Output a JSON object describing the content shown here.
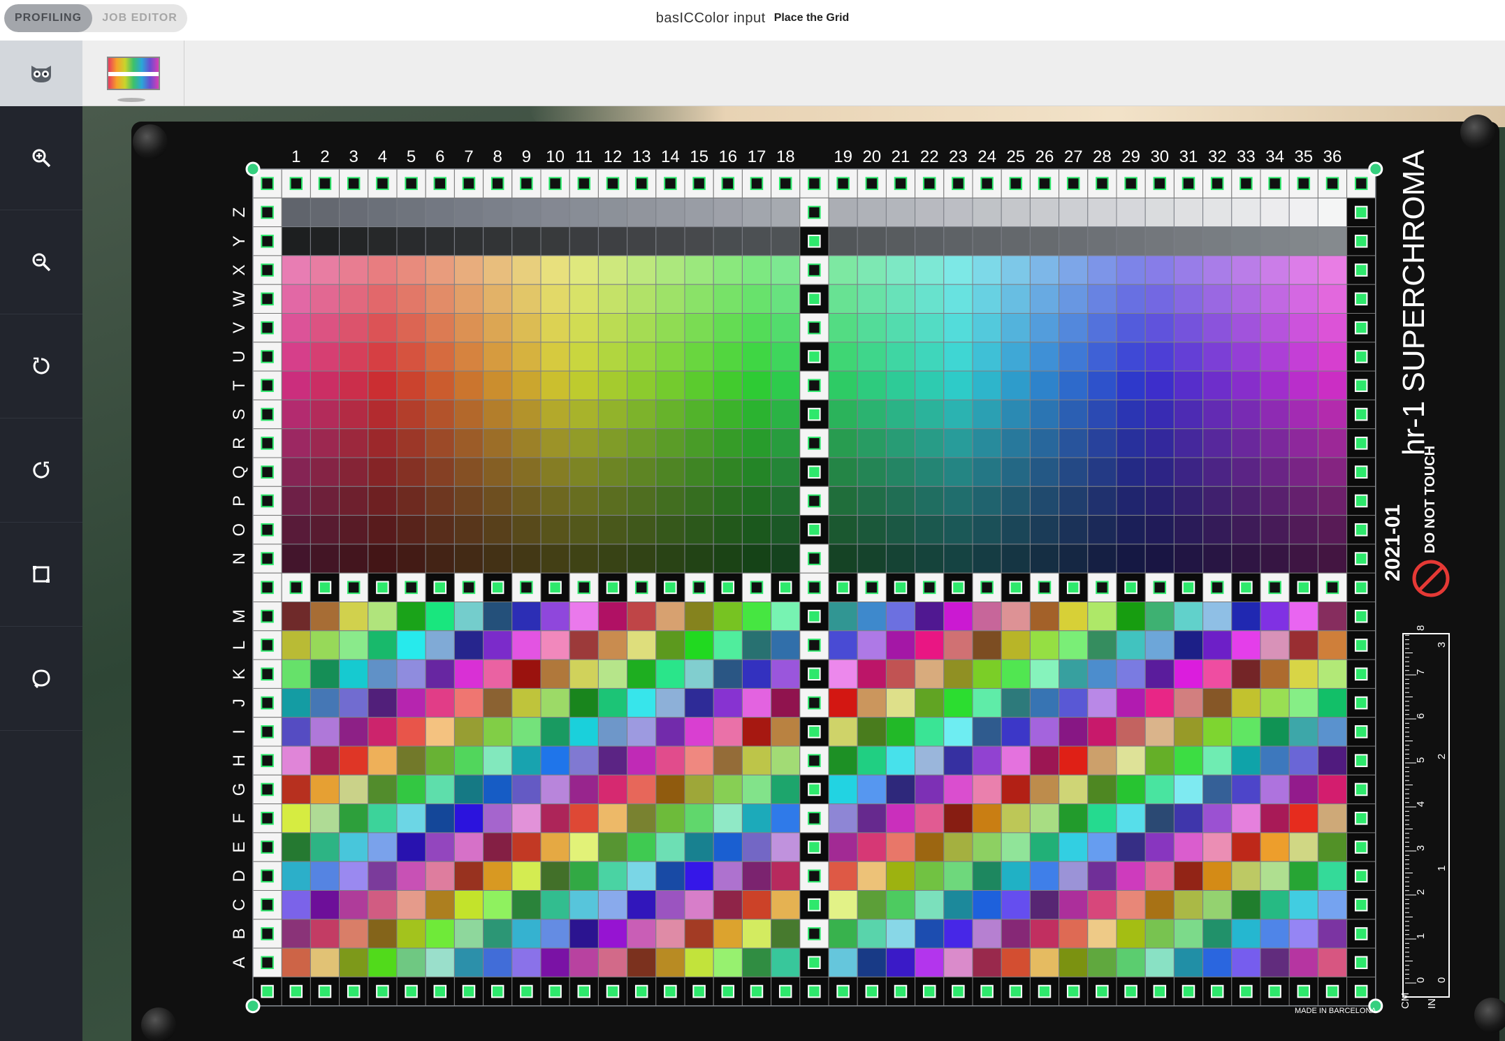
{
  "topbar": {
    "tabs": [
      {
        "label": "PROFILING",
        "active": true
      },
      {
        "label": "JOB EDITOR",
        "active": false
      }
    ],
    "app_title": "basICColor input",
    "step_title": "Place the Grid"
  },
  "toolstrip": {
    "items": [
      {
        "icon": "owl-icon",
        "selected": true
      },
      {
        "icon": "target-thumbnail",
        "selected": false
      }
    ]
  },
  "sidebar": {
    "tools": [
      {
        "icon": "zoom-in-icon"
      },
      {
        "icon": "zoom-out-icon"
      },
      {
        "icon": "rotate-left-icon"
      },
      {
        "icon": "rotate-right-icon"
      },
      {
        "icon": "rectangle-icon"
      },
      {
        "icon": "lasso-icon"
      }
    ]
  },
  "target": {
    "columns": [
      "1",
      "2",
      "3",
      "4",
      "5",
      "6",
      "7",
      "8",
      "9",
      "10",
      "11",
      "12",
      "13",
      "14",
      "15",
      "16",
      "17",
      "18",
      "19",
      "20",
      "21",
      "22",
      "23",
      "24",
      "25",
      "26",
      "27",
      "28",
      "29",
      "30",
      "31",
      "32",
      "33",
      "34",
      "35",
      "36"
    ],
    "rows": [
      "Z",
      "Y",
      "X",
      "W",
      "V",
      "U",
      "T",
      "S",
      "R",
      "Q",
      "P",
      "O",
      "N",
      "M",
      "L",
      "K",
      "J",
      "I",
      "H",
      "G",
      "F",
      "E",
      "D",
      "C",
      "B",
      "A"
    ],
    "brand": "hr-1 SUPERCHROMA",
    "date": "2021-01",
    "warning": "DO NOT TOUCH",
    "made_in": "MADE IN BARCELONA",
    "ruler_units": [
      "CM",
      "IN"
    ],
    "ruler_cm": [
      "0",
      "1",
      "2",
      "3",
      "4",
      "5",
      "6",
      "7",
      "8"
    ],
    "ruler_in": [
      "0",
      "1",
      "2",
      "3"
    ]
  },
  "colors": {
    "sidebar_bg": "#22252d",
    "grid_handle": "#35d07f",
    "grid_line": "#8a8f96"
  }
}
